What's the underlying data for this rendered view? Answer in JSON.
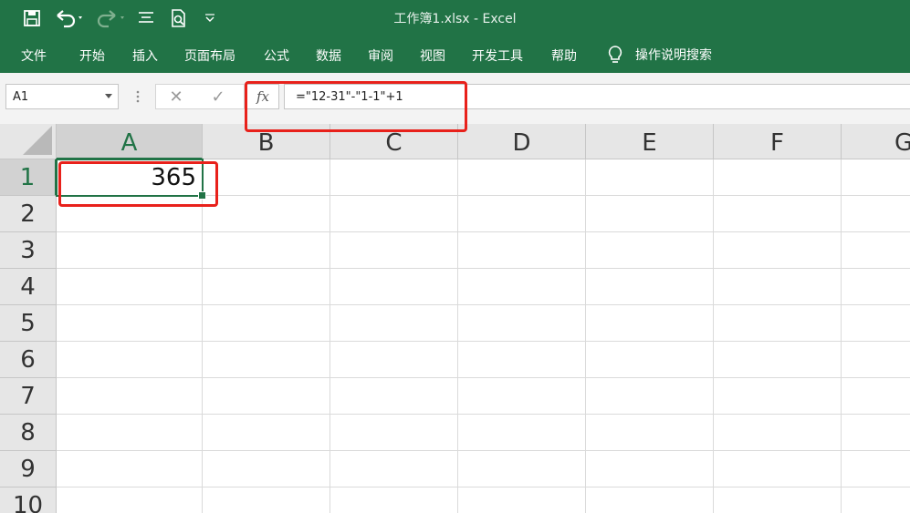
{
  "window": {
    "title": "工作簿1.xlsx  -  Excel"
  },
  "quick_access": {
    "icons": [
      "save-icon",
      "undo-icon",
      "redo-icon",
      "touch-mode-icon",
      "print-preview-icon",
      "customize-icon"
    ]
  },
  "ribbon": {
    "tabs": [
      "文件",
      "开始",
      "插入",
      "页面布局",
      "公式",
      "数据",
      "审阅",
      "视图",
      "开发工具",
      "帮助"
    ],
    "tell_me": "操作说明搜索"
  },
  "formula_bar": {
    "name_box": "A1",
    "cancel_glyph": "✕",
    "enter_glyph": "✓",
    "fx_label": "fx",
    "formula": "=\"12-31\"-\"1-1\"+1"
  },
  "sheet": {
    "columns": [
      "A",
      "B",
      "C",
      "D",
      "E",
      "F",
      "G"
    ],
    "rows": [
      "1",
      "2",
      "3",
      "4",
      "5",
      "6",
      "7",
      "8",
      "9",
      "10"
    ],
    "cells": {
      "A1": "365"
    },
    "selected_cell": "A1"
  },
  "colors": {
    "accent": "#217346",
    "annotation": "#e8211b"
  }
}
